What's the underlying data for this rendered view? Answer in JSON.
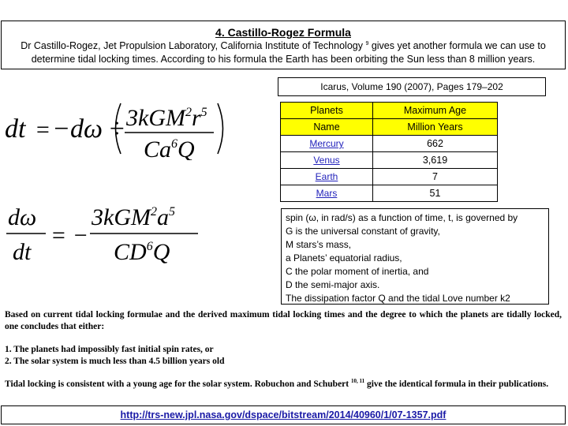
{
  "header": {
    "title": "4. Castillo-Rogez Formula",
    "text_before_ref": "Dr Castillo-Rogez, Jet Propulsion Laboratory, California Institute of Technology ",
    "ref": "9",
    "text_after_ref": " gives yet another formula we can use to determine tidal locking times. According to his formula the Earth has been orbiting the Sun less than 8 million years."
  },
  "formulas": {
    "formula1": {
      "lhs": "dt",
      "equals": "=",
      "rhs_prefix": "−dω ÷",
      "numerator": {
        "base": "3kGM",
        "exp1": "2",
        "mid": "r",
        "exp2": "5"
      },
      "denominator": {
        "base": "Ca",
        "exp": "6",
        "tail": "Q"
      }
    },
    "formula2": {
      "lhs_num": "dω",
      "lhs_den": "dt",
      "equals": "= −",
      "numerator": {
        "base": "3kGM",
        "exp1": "2",
        "mid": "a",
        "exp2": "5"
      },
      "denominator": {
        "base": "CD",
        "exp": "6",
        "tail": "Q"
      }
    }
  },
  "citation": "Icarus, Volume 190 (2007), Pages 179–202",
  "table": {
    "header_row1": [
      "Planets",
      "Maximum Age"
    ],
    "header_row2": [
      "Name",
      "Million Years"
    ],
    "rows": [
      {
        "planet": "Mercury",
        "age": "662"
      },
      {
        "planet": "Venus",
        "age": "3,619"
      },
      {
        "planet": "Earth",
        "age": "7"
      },
      {
        "planet": "Mars",
        "age": "51"
      }
    ],
    "colors": {
      "header_bg": "#ffff00",
      "link": "#2222bb"
    }
  },
  "definitions": [
    "spin (ω, in rad/s) as a function of time, t, is governed by",
    "G is the universal constant of gravity,",
    "M stars’s mass,",
    "a Planets’ equatorial radius,",
    "C the polar moment of inertia, and",
    "D the semi-major axis.",
    "The dissipation factor Q and the tidal Love number k2"
  ],
  "body": {
    "para1": "Based on current tidal locking formulae and the derived maximum tidal locking times and the degree to which the planets are tidally locked, one concludes that either:",
    "list": [
      "1. The planets had impossibly fast initial spin rates, or",
      "2. The solar system is much less than 4.5 billion years old"
    ],
    "para2_before": "Tidal locking is consistent with a young age for the solar system. Robuchon and Schubert ",
    "para2_ref": "10, 11",
    "para2_after": " give the identical formula in their publications."
  },
  "source_link": "http://trs-new.jpl.nasa.gov/dspace/bitstream/2014/40960/1/07-1357.pdf"
}
